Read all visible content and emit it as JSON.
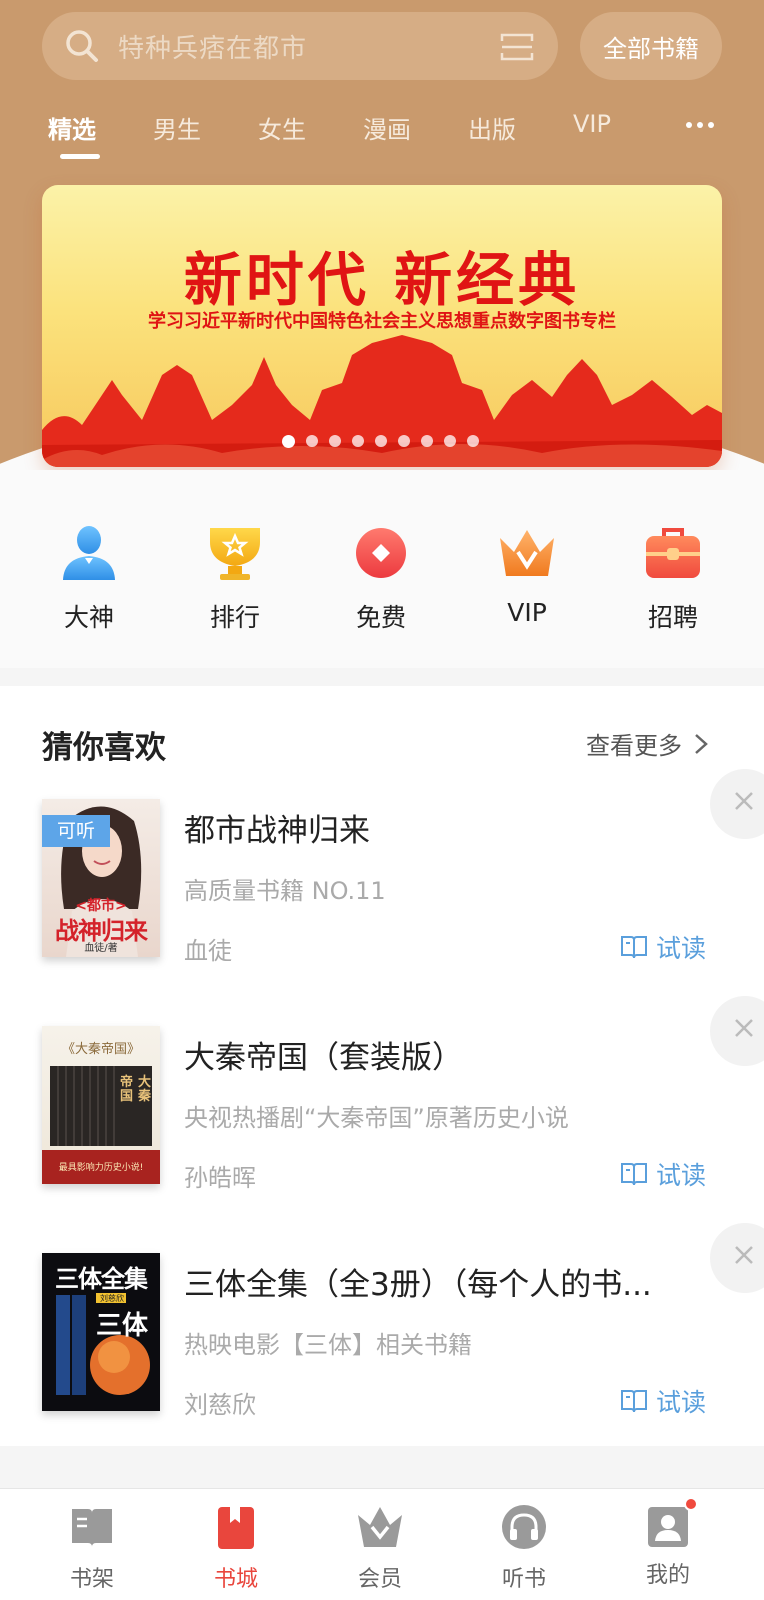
{
  "search": {
    "placeholder": "特种兵痞在都市",
    "all_books_label": "全部书籍"
  },
  "tabs": [
    {
      "label": "精选",
      "active": true
    },
    {
      "label": "男生"
    },
    {
      "label": "女生"
    },
    {
      "label": "漫画"
    },
    {
      "label": "出版"
    },
    {
      "label": "VIP"
    }
  ],
  "banner": {
    "title": "新时代 新经典",
    "subtitle": "学习习近平新时代中国特色社会主义思想重点数字图书专栏",
    "slide_count": 9,
    "active_slide": 1
  },
  "quick_links": [
    {
      "label": "大神",
      "icon": "person-icon"
    },
    {
      "label": "排行",
      "icon": "trophy-icon"
    },
    {
      "label": "免费",
      "icon": "free-icon"
    },
    {
      "label": "VIP",
      "icon": "crown-icon"
    },
    {
      "label": "招聘",
      "icon": "briefcase-icon"
    }
  ],
  "guess": {
    "title": "猜你喜欢",
    "more_label": "查看更多",
    "books": [
      {
        "name": "都市战神归来",
        "desc": "高质量书籍 NO.11",
        "author": "血徒",
        "try_label": "试读",
        "badge": "可听",
        "cover_text": [
          "<都市>",
          "战神归来",
          "血徒/著"
        ]
      },
      {
        "name": "大秦帝国（套装版）",
        "desc": "央视热播剧“大秦帝国”原著历史小说",
        "author": "孙皓晖",
        "try_label": "试读",
        "cover_text": [
          "《大秦帝国》",
          "大秦",
          "帝国",
          "最具影响力历史小说!"
        ]
      },
      {
        "name": "三体全集（全3册）（每个人的书...",
        "desc": "热映电影【三体】相关书籍",
        "author": "刘慈欣",
        "try_label": "试读",
        "cover_text": [
          "三体全集",
          "刘慈欣",
          "三体"
        ]
      }
    ]
  },
  "bottom_nav": [
    {
      "label": "书架",
      "icon": "bookshelf-icon"
    },
    {
      "label": "书城",
      "icon": "bookstore-icon",
      "active": true
    },
    {
      "label": "会员",
      "icon": "member-icon"
    },
    {
      "label": "听书",
      "icon": "headphones-icon"
    },
    {
      "label": "我的",
      "icon": "profile-icon",
      "badge_dot": true
    }
  ],
  "colors": {
    "header_brown": "#c99a6d",
    "accent_red": "#e9463d",
    "link_blue": "#5a9fdc"
  }
}
